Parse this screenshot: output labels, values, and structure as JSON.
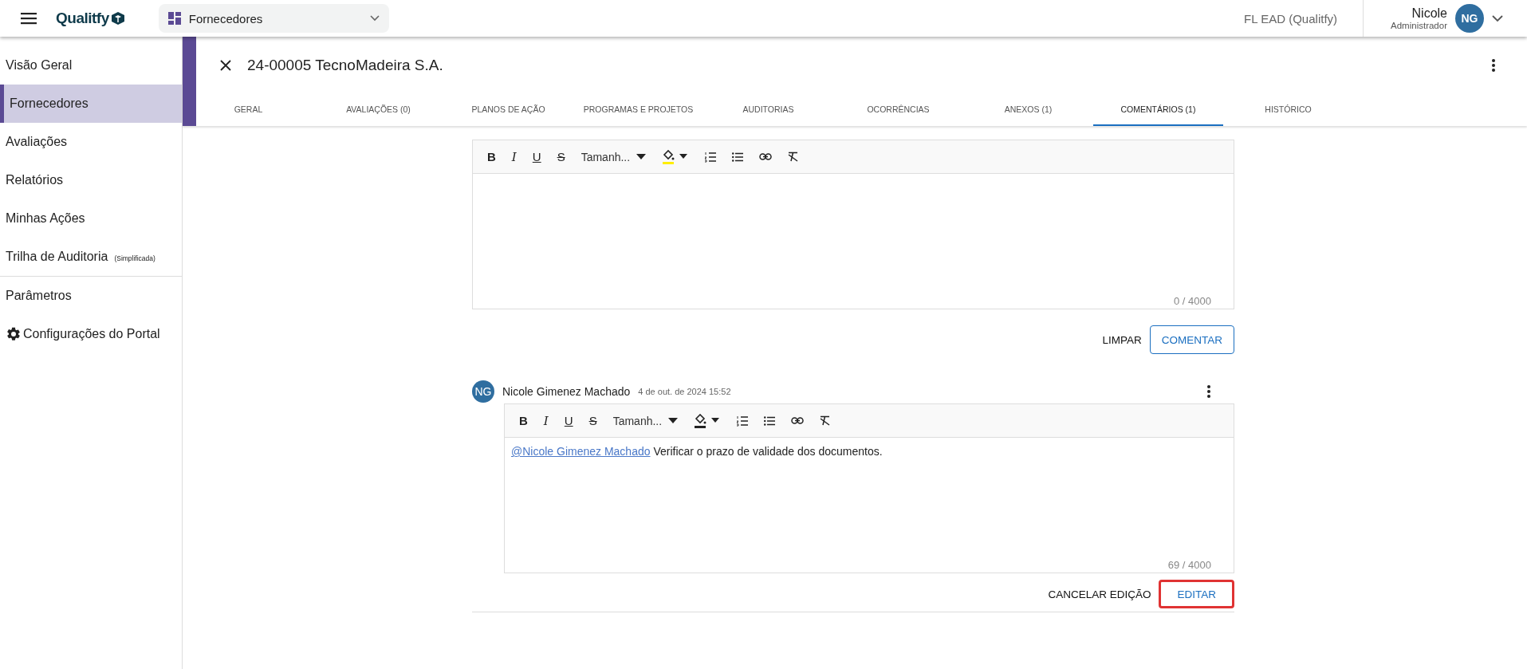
{
  "header": {
    "logo": "Qualitfy",
    "module": "Fornecedores",
    "org": "FL EAD (Qualitfy)",
    "user": {
      "name": "Nicole",
      "role": "Administrador",
      "initials": "NG"
    }
  },
  "sidebar": {
    "items": [
      {
        "label": "Visão Geral",
        "kind": "link",
        "selected": false
      },
      {
        "label": "Fornecedores",
        "selected": true
      },
      {
        "label": "Avaliações",
        "selected": false
      },
      {
        "label": "Relatórios",
        "selected": false
      },
      {
        "label": "Minhas Ações",
        "selected": false
      },
      {
        "label": "Trilha de Auditoria",
        "note": "(Simplificada)",
        "selected": false
      },
      {
        "label": "Parâmetros",
        "divider_before": true,
        "selected": false
      },
      {
        "label": "Configurações do Portal",
        "kind": "settings",
        "selected": false
      }
    ]
  },
  "record": {
    "title": "24-00005 TecnoMadeira S.A.",
    "tabs": [
      {
        "label": "GERAL",
        "selected": false
      },
      {
        "label": "AVALIAÇÕES (0)",
        "selected": false
      },
      {
        "label": "PLANOS DE AÇÃO",
        "selected": false
      },
      {
        "label": "PROGRAMAS E PROJETOS",
        "selected": false
      },
      {
        "label": "AUDITORIAS",
        "selected": false
      },
      {
        "label": "OCORRÊNCIAS",
        "selected": false
      },
      {
        "label": "ANEXOS (1)",
        "selected": false
      },
      {
        "label": "COMENTÁRIOS (1)",
        "selected": true
      },
      {
        "label": "HISTÓRICO",
        "selected": false
      }
    ]
  },
  "new_comment": {
    "toolbar": [
      {
        "kind": "bold",
        "label": "B"
      },
      {
        "kind": "italic",
        "label": "I"
      },
      {
        "kind": "underline",
        "label": "U"
      },
      {
        "kind": "strike",
        "label": "S"
      },
      {
        "kind": "size",
        "label": "Tamanh..."
      },
      {
        "kind": "color",
        "color": "#ffee00"
      },
      {
        "kind": "ol"
      },
      {
        "kind": "ul"
      },
      {
        "kind": "link"
      },
      {
        "kind": "clear"
      }
    ],
    "counter": "0 / 4000",
    "buttons": [
      {
        "label": "LIMPAR",
        "kind": "plain",
        "highlighted": false
      },
      {
        "label": "COMENTAR",
        "kind": "outlined",
        "highlighted": false
      }
    ]
  },
  "comments": [
    {
      "author": "Nicole Gimenez Machado",
      "initials": "NG",
      "date": "4 de out. de 2024 15:52",
      "toolbar": [
        {
          "kind": "bold",
          "label": "B"
        },
        {
          "kind": "italic",
          "label": "I"
        },
        {
          "kind": "underline",
          "label": "U"
        },
        {
          "kind": "strike",
          "label": "S"
        },
        {
          "kind": "size",
          "label": "Tamanh..."
        },
        {
          "kind": "color",
          "color": "#222222"
        },
        {
          "kind": "ol"
        },
        {
          "kind": "ul"
        },
        {
          "kind": "link"
        },
        {
          "kind": "clear"
        }
      ],
      "mention": "@Nicole Gimenez Machado",
      "text": "Verificar o prazo de validade dos documentos.",
      "counter": "69 / 4000",
      "buttons": [
        {
          "label": "CANCELAR EDIÇÃO",
          "kind": "plain",
          "highlighted": false
        },
        {
          "label": "EDITAR",
          "kind": "primary",
          "highlighted": true
        }
      ]
    }
  ]
}
